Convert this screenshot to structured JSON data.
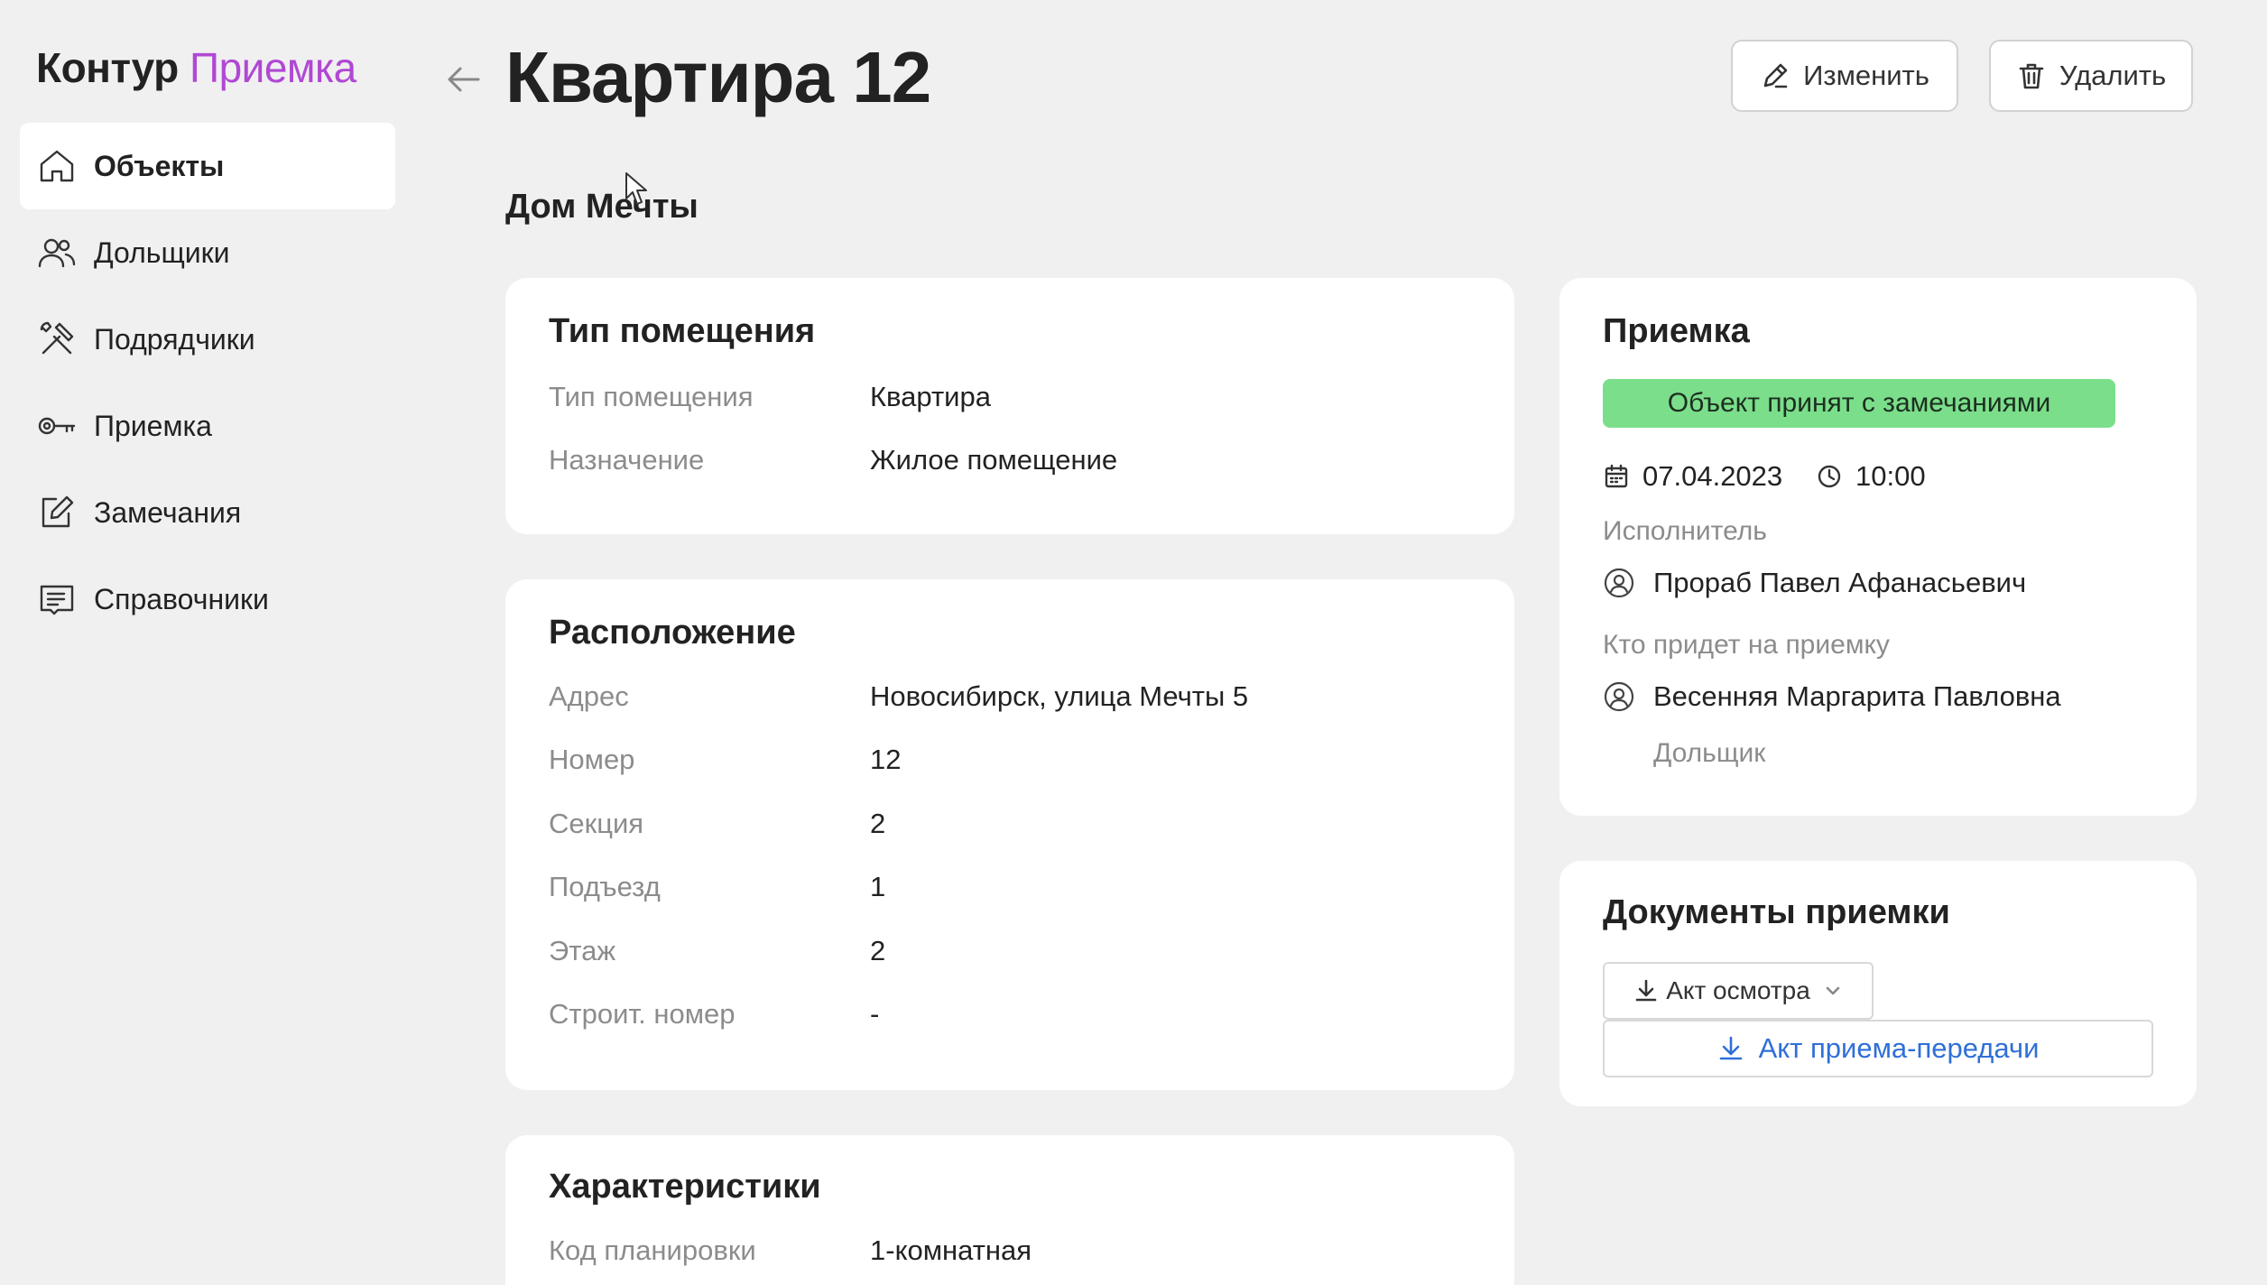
{
  "brand": {
    "part1": "Контур",
    "part2": "Приемка"
  },
  "sidebar": {
    "items": [
      {
        "label": "Объекты",
        "icon": "home-icon",
        "active": true
      },
      {
        "label": "Дольщики",
        "icon": "users-icon"
      },
      {
        "label": "Подрядчики",
        "icon": "tools-icon"
      },
      {
        "label": "Приемка",
        "icon": "key-icon"
      },
      {
        "label": "Замечания",
        "icon": "edit-note-icon"
      },
      {
        "label": "Справочники",
        "icon": "book-icon"
      }
    ]
  },
  "header": {
    "title": "Квартира 12",
    "subtitle": "Дом Мечты",
    "edit_label": "Изменить",
    "delete_label": "Удалить"
  },
  "room_type": {
    "title": "Тип помещения",
    "rows": [
      {
        "label": "Тип помещения",
        "value": "Квартира"
      },
      {
        "label": "Назначение",
        "value": "Жилое помещение"
      }
    ]
  },
  "location": {
    "title": "Расположение",
    "rows": [
      {
        "label": "Адрес",
        "value": "Новосибирск, улица Мечты 5"
      },
      {
        "label": "Номер",
        "value": "12"
      },
      {
        "label": "Секция",
        "value": "2"
      },
      {
        "label": "Подъезд",
        "value": "1"
      },
      {
        "label": "Этаж",
        "value": "2"
      },
      {
        "label": "Строит. номер",
        "value": "-"
      }
    ]
  },
  "characteristics": {
    "title": "Характеристики",
    "rows": [
      {
        "label": "Код планировки",
        "value": "1-комнатная"
      }
    ]
  },
  "acceptance": {
    "title": "Приемка",
    "status": "Объект принят с замечаниями",
    "status_color": "#7bde8b",
    "date": "07.04.2023",
    "time": "10:00",
    "executor_label": "Исполнитель",
    "executor_name": "Прораб Павел Афанасьевич",
    "attendee_label": "Кто придет на приемку",
    "attendee_name": "Весенняя Маргарита Павловна",
    "attendee_role": "Дольщик"
  },
  "documents": {
    "title": "Документы приемки",
    "inspection_act": "Акт осмотра",
    "transfer_act": "Акт приема-передачи",
    "link_color": "#2f6fd8"
  }
}
